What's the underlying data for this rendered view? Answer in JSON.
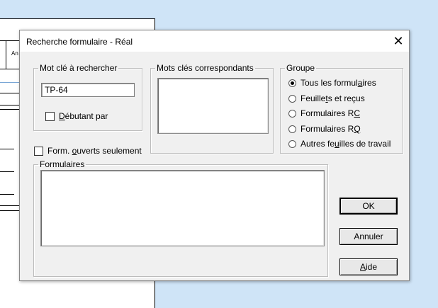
{
  "dialog": {
    "title": "Recherche formulaire - Réal",
    "close_glyph": "✕"
  },
  "background": {
    "cell_text": "An"
  },
  "keyword": {
    "legend": "Mot clé à rechercher",
    "value": "TP-64",
    "starts_with_label": "Débutant par",
    "starts_with_checked": false
  },
  "matches": {
    "legend": "Mots clés correspondants",
    "items": []
  },
  "group": {
    "legend": "Groupe",
    "options": [
      {
        "label": "Tous les formulaires",
        "selected": true
      },
      {
        "label": "Feuillets et reçus",
        "selected": false
      },
      {
        "label": "Formulaires RC",
        "selected": false
      },
      {
        "label": "Formulaires RQ",
        "selected": false
      },
      {
        "label": "Autres feuilles de travail",
        "selected": false
      }
    ]
  },
  "open_only": {
    "label": "Form. ouverts seulement",
    "checked": false
  },
  "forms": {
    "legend": "Formulaires",
    "items": []
  },
  "buttons": {
    "ok": "OK",
    "cancel": "Annuler",
    "help": "Aide"
  }
}
